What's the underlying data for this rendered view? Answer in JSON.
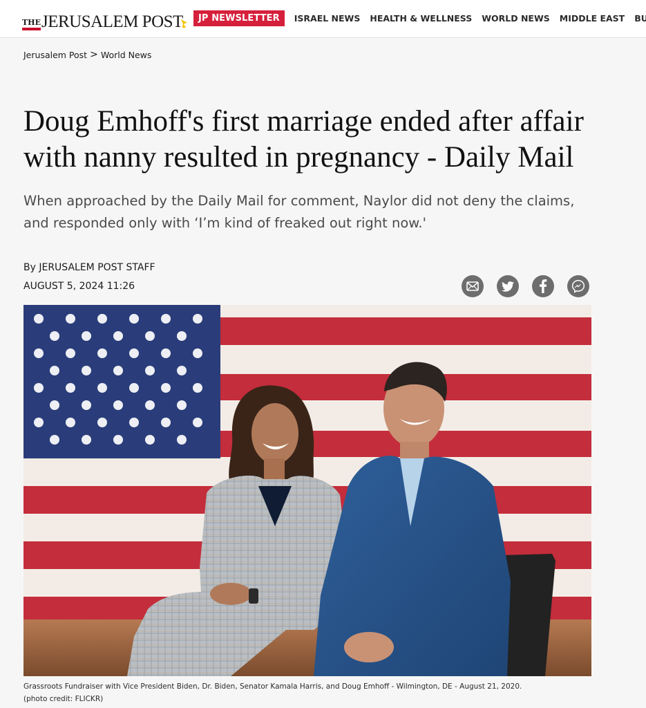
{
  "site": {
    "logo_the": "THE",
    "logo_name": "JERUSALEM POST"
  },
  "nav": {
    "newsletter": "JP NEWSLETTER",
    "items": [
      "ISRAEL NEWS",
      "HEALTH & WELLNESS",
      "WORLD NEWS",
      "MIDDLE EAST",
      "BUSINESS &"
    ]
  },
  "breadcrumb": {
    "home": "Jerusalem Post",
    "separator": ">",
    "section": "World News"
  },
  "article": {
    "headline": "Doug Emhoff's first marriage ended after affair with nanny resulted in pregnancy - Daily Mail",
    "subhead": "When approached by the Daily Mail for comment, Naylor did not deny the claims, and responded only with ‘I’m kind of freaked out right now.'",
    "byline_prefix": "By",
    "author": "JERUSALEM POST STAFF",
    "date": "AUGUST 5, 2024 11:26"
  },
  "share": {
    "icons": [
      "email-icon",
      "twitter-icon",
      "facebook-icon",
      "messenger-icon"
    ],
    "color": "#6d6d6d"
  },
  "photo": {
    "caption": "Grassroots Fundraiser with Vice President Biden, Dr. Biden, Senator Kamala Harris, and Doug Emhoff - Wilmington, DE - August 21, 2020.",
    "credit": "(photo credit: FLICKR)"
  },
  "colors": {
    "accent_red": "#d6203b",
    "background": "#f6f6f6"
  }
}
